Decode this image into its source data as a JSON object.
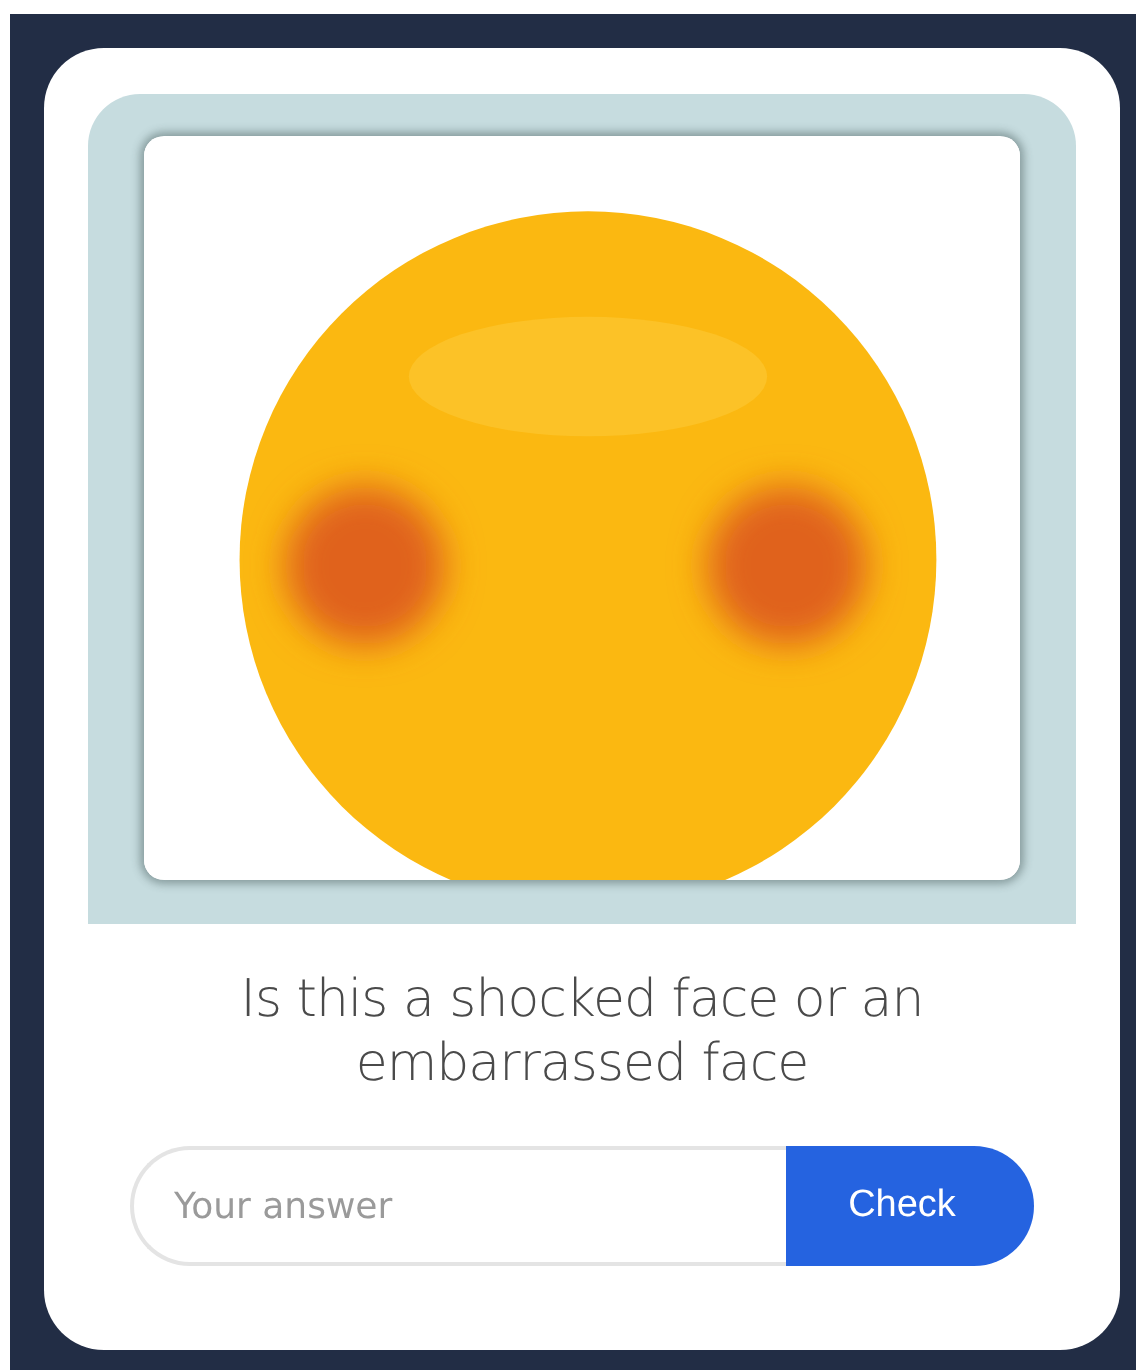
{
  "question": "Is this a shocked face or an embarrassed face",
  "answer": {
    "placeholder": "Your answer"
  },
  "check_button": "Check"
}
